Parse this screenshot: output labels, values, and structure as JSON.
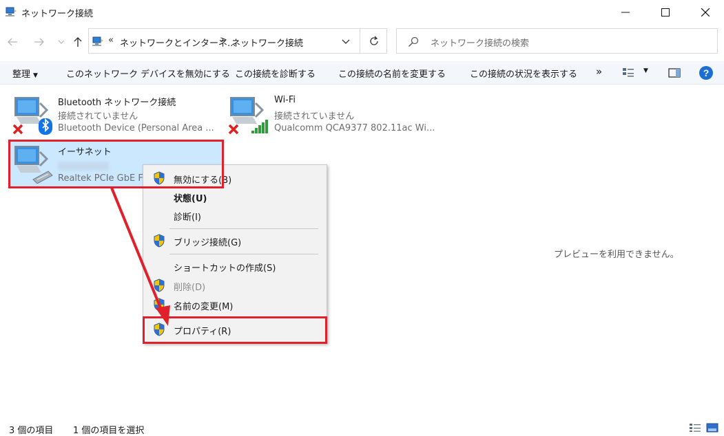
{
  "window": {
    "title": "ネットワーク接続"
  },
  "address": {
    "prefix": "«",
    "crumb1": "ネットワークとインターネ...",
    "separator": ">",
    "crumb2": "ネットワーク接続"
  },
  "search": {
    "placeholder": "ネットワーク接続の検索"
  },
  "commands": {
    "organize": "整理",
    "disable": "このネットワーク デバイスを無効にする",
    "diagnose": "この接続を診断する",
    "rename": "この接続の名前を変更する",
    "status": "この接続の状況を表示する",
    "more": "»",
    "help": "?"
  },
  "connections": [
    {
      "name": "Bluetooth ネットワーク接続",
      "status": "接続されていません",
      "device": "Bluetooth Device (Personal Area ..."
    },
    {
      "name": "Wi-Fi",
      "status": "接続されていません",
      "device": "Qualcomm QCA9377 802.11ac Wi..."
    },
    {
      "name": "イーサネット",
      "status": "",
      "device": "Realtek PCIe GbE Fa"
    }
  ],
  "preview": {
    "message": "プレビューを利用できません。"
  },
  "context_menu": {
    "items": [
      {
        "label": "無効にする(B)",
        "shield": true,
        "bold": false,
        "disabled": false
      },
      {
        "label": "状態(U)",
        "shield": false,
        "bold": true,
        "disabled": false
      },
      {
        "label": "診断(I)",
        "shield": false,
        "bold": false,
        "disabled": false
      },
      {
        "label": "ブリッジ接続(G)",
        "shield": true,
        "bold": false,
        "disabled": false
      },
      {
        "label": "ショートカットの作成(S)",
        "shield": false,
        "bold": false,
        "disabled": false
      },
      {
        "label": "削除(D)",
        "shield": true,
        "bold": false,
        "disabled": true
      },
      {
        "label": "名前の変更(M)",
        "shield": true,
        "bold": false,
        "disabled": false
      },
      {
        "label": "プロパティ(R)",
        "shield": true,
        "bold": false,
        "disabled": false
      }
    ]
  },
  "statusbar": {
    "count": "3 個の項目",
    "selected": "1 個の項目を選択"
  },
  "colors": {
    "accent": "#1c6fd1",
    "highlight": "#e0202a",
    "selection": "#cce8ff"
  },
  "icons": {
    "app": "network-connections-icon",
    "back": "back-arrow-icon",
    "forward": "forward-arrow-icon",
    "up": "up-arrow-icon",
    "search": "search-icon",
    "refresh": "refresh-icon",
    "shield": "uac-shield-icon"
  }
}
